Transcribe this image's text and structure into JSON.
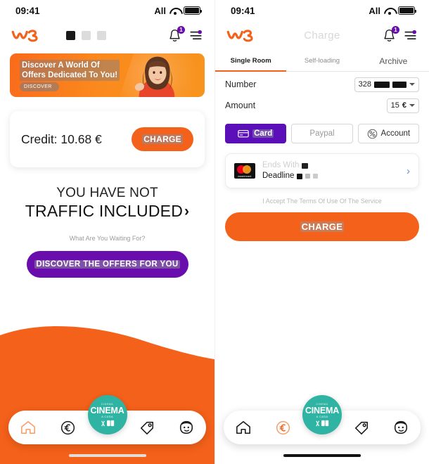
{
  "status_bar": {
    "time": "09:41",
    "carrier": "All",
    "icons": [
      "signal-icon",
      "wifi-icon",
      "battery-icon"
    ]
  },
  "brand": {
    "logo_text": "w3",
    "color_orange": "#f4611a",
    "color_purple": "#6a0dad",
    "color_teal": "#2fb3a3"
  },
  "left_screen": {
    "header": {
      "title": "",
      "notification_count": "1",
      "icons": [
        "bell-icon",
        "filter-icon"
      ],
      "carousel_dots": 3,
      "active_dot": 0
    },
    "banner": {
      "line1": "Discover A World Of",
      "line2": "Offers Dedicated To You!",
      "cta": "DISCOVER"
    },
    "credit_card": {
      "label": "Credit: 10.68 €",
      "amount": "10.68",
      "currency": "€",
      "button": "CHARGE"
    },
    "headline": {
      "line1": "YOU HAVE NOT",
      "line2": "TRAFFIC INCLUDED",
      "chevron": "›"
    },
    "sub_question": "What Are You Waiting For?",
    "discover_button": "DISCOVER THE OFFERS FOR YOU",
    "nav": {
      "items": [
        "home-icon",
        "euro-icon",
        "cinema-badge",
        "tag-icon",
        "account-icon"
      ],
      "active": "home-icon"
    }
  },
  "right_screen": {
    "header": {
      "title": "Charge",
      "notification_count": "1"
    },
    "tabs": [
      {
        "label": "Single Room",
        "active": true
      },
      {
        "label": "Self-loading",
        "active": false
      },
      {
        "label": "Archive",
        "active": false
      }
    ],
    "form": {
      "number": {
        "label": "Number",
        "value_prefix": "328",
        "value_redacted": true
      },
      "amount": {
        "label": "Amount",
        "value": "15",
        "currency": "€"
      }
    },
    "methods": [
      {
        "label": "Card",
        "icon": "credit-card-icon",
        "active": true
      },
      {
        "label": "Paypal",
        "icon": "",
        "active": false
      },
      {
        "label": "Account",
        "icon": "percent-icon",
        "active": false
      }
    ],
    "saved_card": {
      "brand": "mastercard",
      "brand_text": "mastercard",
      "line1_label": "Ends With",
      "line2_label": "Deadline",
      "chevron": "›"
    },
    "terms": "I Accept The Terms Of Use Of The Service",
    "charge_button": "CHARGE",
    "nav": {
      "items": [
        "home-icon",
        "euro-icon",
        "cinema-badge",
        "tag-icon",
        "account-icon"
      ],
      "active": "euro-icon"
    }
  },
  "cinema_badge": {
    "top": "CINEMA",
    "main": "CINEMA",
    "sub": "A CASA"
  }
}
